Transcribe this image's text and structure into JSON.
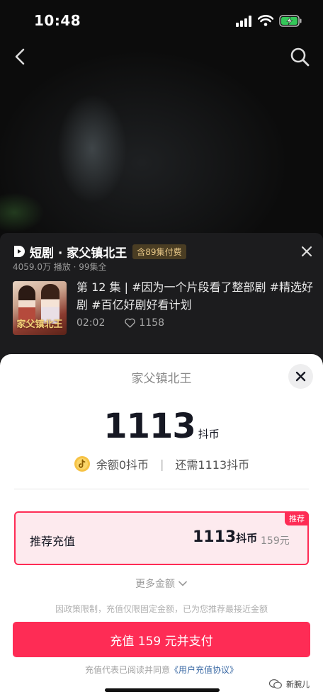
{
  "status_bar": {
    "time": "10:48"
  },
  "drama_card": {
    "title": "短剧 · 家父镇北王",
    "paid_badge": "含89集付费",
    "subtitle": "4059.0万 播放 · 99集全",
    "thumbnail_text": "家父镇北王",
    "episode_desc": "第 12 集 | #因为一个片段看了整部剧 #精选好剧 #百亿好剧好看计划",
    "duration": "02:02",
    "likes": "1158"
  },
  "sheet": {
    "title": "家父镇北王",
    "amount": "1113",
    "amount_unit": "抖币",
    "balance": "余额0抖币",
    "separator": "|",
    "needed": "还需1113抖币",
    "option": {
      "badge": "推荐",
      "label": "推荐充值",
      "coins": "1113",
      "coins_unit": "抖币",
      "price": "159元"
    },
    "more_label": "更多金额",
    "policy_note": "因政策限制，充值仅限固定金额，已为您推荐最接近金额",
    "pay_button": "充值 159 元并支付",
    "agree_prefix": "充值代表已阅读并同意",
    "agree_link": "《用户充值协议》"
  },
  "watermark": {
    "text": "新腕儿"
  },
  "colors": {
    "accent": "#fe2c55",
    "badge_bg": "#4a3d23",
    "badge_text": "#e8c887"
  }
}
